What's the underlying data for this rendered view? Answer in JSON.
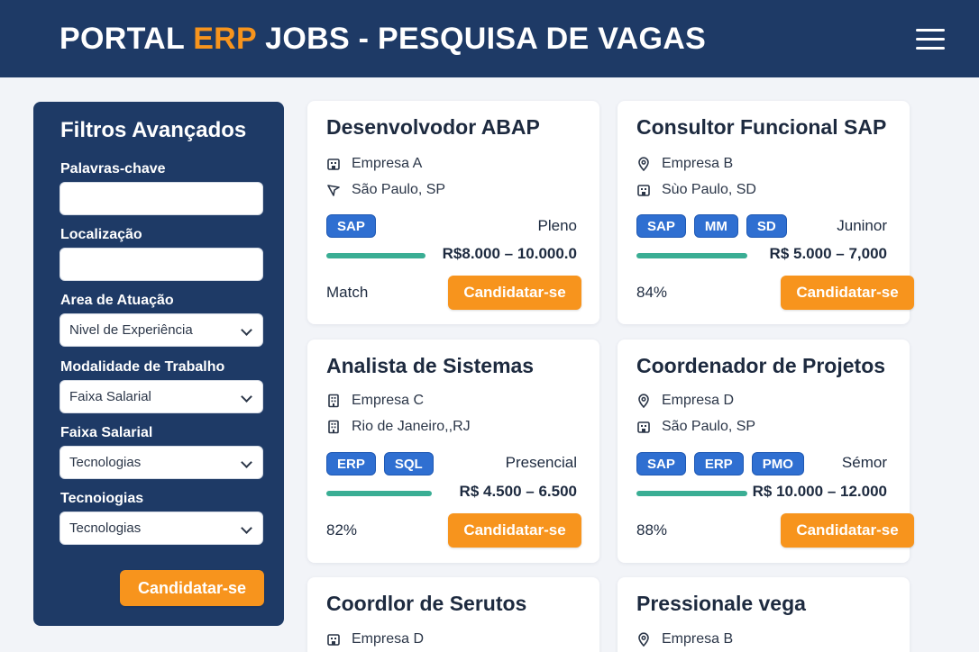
{
  "header": {
    "title_part1": "PORTAL ",
    "title_accent": "ERP",
    "title_part2": " JOBS - PESQUISA DE VAGAS",
    "menu_icon": "hamburger-menu-icon"
  },
  "sidebar": {
    "title": "Filtros Avançados",
    "keywords_label": "Palavras-chave",
    "keywords_value": "",
    "location_label": "Localização",
    "location_value": "",
    "area_label": "Area de Atuação",
    "area_select": "Nivel de Experiência",
    "modality_label": "Modalidade de Trabalho",
    "modality_select": "Faixa Salarial",
    "salary_label": "Faixa Salarial",
    "salary_select": "Tecnologias",
    "tech_label": "Tecnoiogias",
    "tech_select": "Tecnologias",
    "button": "Candidatar-se"
  },
  "colors": {
    "primary": "#1e3a66",
    "accent": "#f7941d",
    "tag": "#2f6fd1",
    "match_bar": "#3aae94"
  },
  "jobs": [
    {
      "title": "Desenvolvodor ABAP",
      "company": "Empresa A",
      "location": "São Paulo, SP",
      "company_icon": "building-icon",
      "location_icon": "navigation-arrow-icon",
      "tags": [
        "SAP"
      ],
      "level": "Pleno",
      "salary": "R$8.000 – 10.000.0",
      "match": "Match",
      "match_fraction": 0.34,
      "button": "Candidatar-se"
    },
    {
      "title": "Consultor Funcional SAP",
      "company": "Empresa B",
      "location": "Sùo Paulo, SD",
      "company_icon": "location-pin-icon",
      "location_icon": "building-icon",
      "tags": [
        "SAP",
        "MM",
        "SD"
      ],
      "level": "Juninor",
      "salary": "R$ 5.000 – 7,000",
      "match": "84%",
      "match_fraction": 0.38,
      "button": "Candidatar-se"
    },
    {
      "title": "Analista de Sistemas",
      "company": "Empresa C",
      "location": "Rio de Janeiro,,RJ",
      "company_icon": "office-building-icon",
      "location_icon": "building-icon",
      "tags": [
        "ERP",
        "SQL"
      ],
      "level": "Presencial",
      "salary": "R$ 4.500 – 6.500",
      "match": "82%",
      "match_fraction": 0.36,
      "button": "Candidatar-se"
    },
    {
      "title": "Coordenador de Projetos",
      "company": "Empresa D",
      "location": "São Paulo, SP",
      "company_icon": "location-pin-icon",
      "location_icon": "building-icon",
      "tags": [
        "SAP",
        "ERP",
        "PMO"
      ],
      "level": "Sémor",
      "salary": "R$ 10.000 – 12.000",
      "match": "88%",
      "match_fraction": 0.38,
      "button": "Candidatar-se"
    },
    {
      "title": "Coordlor de Serutos",
      "company": "Empresa D",
      "company_icon": "building-icon"
    },
    {
      "title": "Pressionale vega",
      "company": "Empresa B",
      "company_icon": "location-pin-icon"
    }
  ]
}
